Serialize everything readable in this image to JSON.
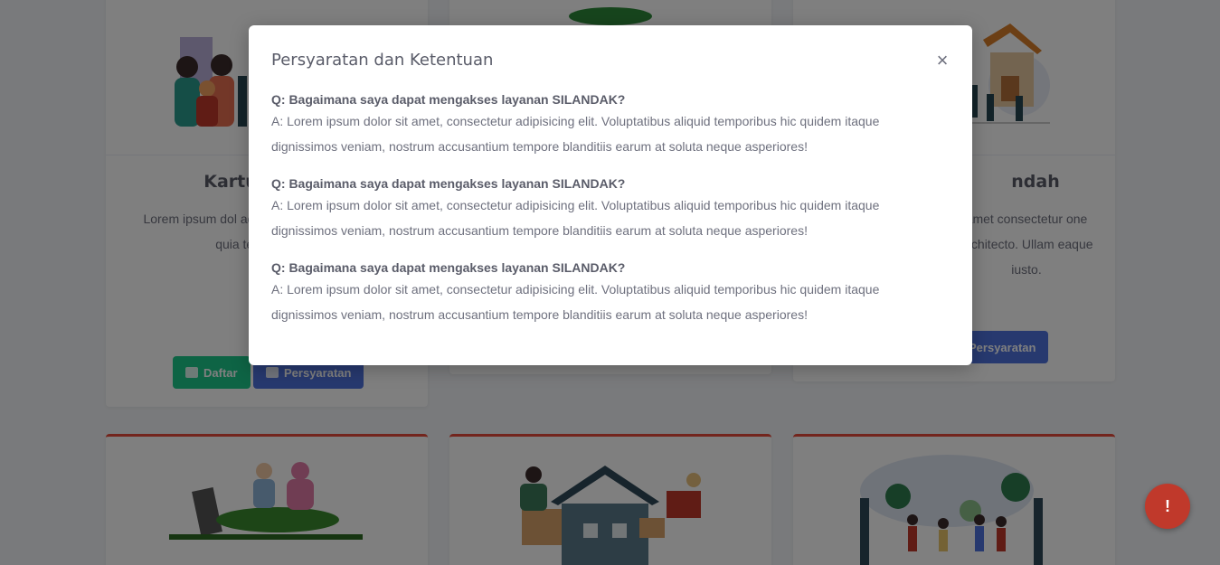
{
  "background": {
    "cards_top": [
      {
        "title": "Kartu",
        "text": "Lorem ipsum dol adipisicing elit. Nam omnis quia temp consect",
        "btn_primary": "Daftar",
        "btn_secondary": "Persyaratan"
      },
      {
        "title": "",
        "text": "",
        "btn_primary": "",
        "btn_secondary": ""
      },
      {
        "title": "ndah",
        "text": "amet consectetur one architecto. Ullam eaque iusto.",
        "btn_primary": "",
        "btn_secondary": "Persyaratan"
      }
    ]
  },
  "modal": {
    "title": "Persyaratan dan Ketentuan",
    "close_label": "×",
    "items": [
      {
        "q": "Q: Bagaimana saya dapat mengakses layanan SILANDAK?",
        "a": "A: Lorem ipsum dolor sit amet, consectetur adipisicing elit. Voluptatibus aliquid temporibus hic quidem itaque dignissimos veniam, nostrum accusantium tempore blanditiis earum at soluta neque asperiores!"
      },
      {
        "q": "Q: Bagaimana saya dapat mengakses layanan SILANDAK?",
        "a": "A: Lorem ipsum dolor sit amet, consectetur adipisicing elit. Voluptatibus aliquid temporibus hic quidem itaque dignissimos veniam, nostrum accusantium tempore blanditiis earum at soluta neque asperiores!"
      },
      {
        "q": "Q: Bagaimana saya dapat mengakses layanan SILANDAK?",
        "a": "A: Lorem ipsum dolor sit amet, consectetur adipisicing elit. Voluptatibus aliquid temporibus hic quidem itaque dignissimos veniam, nostrum accusantium tempore blanditiis earum at soluta neque asperiores!"
      }
    ]
  },
  "fab": {
    "label": "!"
  },
  "colors": {
    "green": "#1cc88a",
    "blue": "#4e73df",
    "red": "#e74a3b"
  }
}
